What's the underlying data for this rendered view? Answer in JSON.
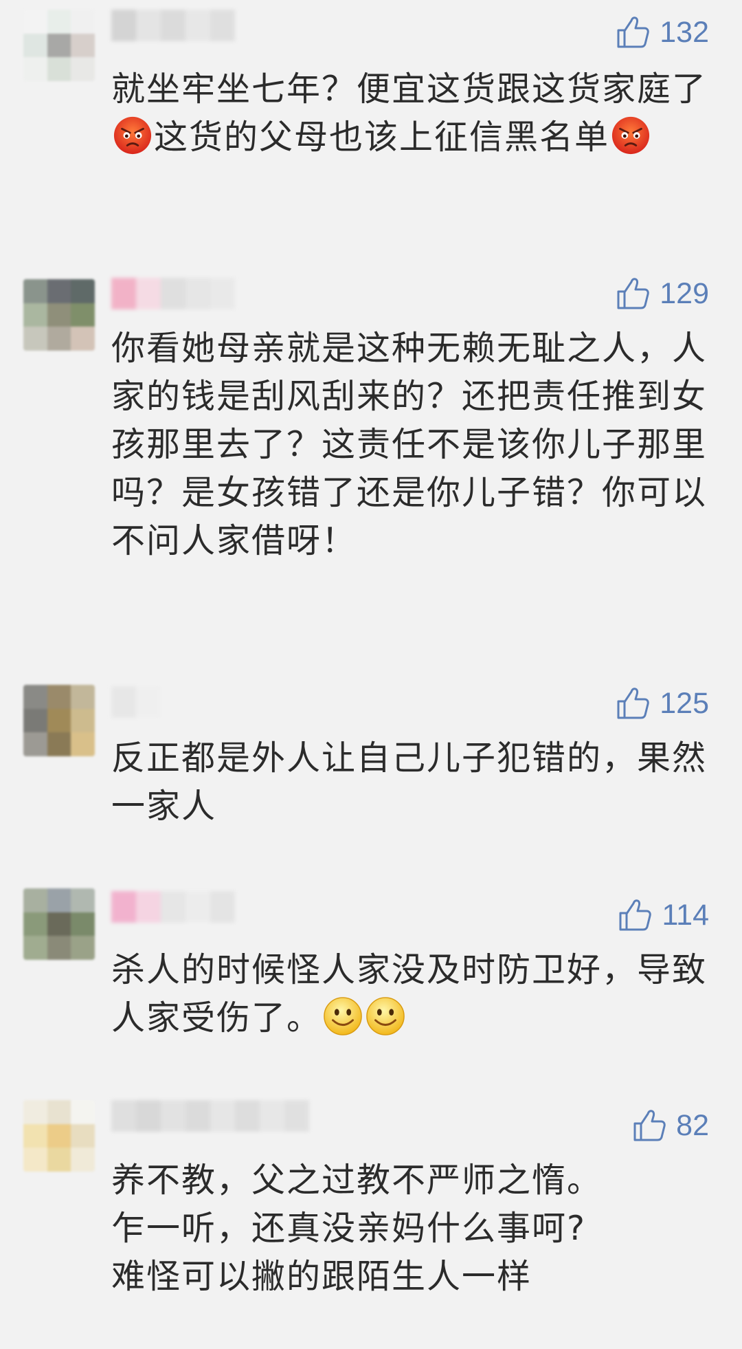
{
  "comments": [
    {
      "likes": "132",
      "text_parts": [
        "就坐牢坐七年？便宜这货跟这货家庭了",
        "这货的父母也该上征信黑名单"
      ],
      "emoji": "angry-face-icon"
    },
    {
      "likes": "129",
      "text": "你看她母亲就是这种无赖无耻之人，人家的钱是刮风刮来的？还把责任推到女孩那里去了？这责任不是该你儿子那里吗？是女孩错了还是你儿子错？你可以不问人家借呀！"
    },
    {
      "likes": "125",
      "text": "反正都是外人让自己儿子犯错的，果然一家人"
    },
    {
      "likes": "114",
      "text": "杀人的时候怪人家没及时防卫好，导致人家受伤了。",
      "emoji": "smiling-face-icon"
    },
    {
      "likes": "82",
      "lines": [
        "养不教，父之过教不严师之惰。",
        "乍一听，还真没亲妈什么事呵?",
        "难怪可以撇的跟陌生人一样"
      ]
    }
  ],
  "colors": {
    "background": "#f2f2f2",
    "like_blue": "#5b7fb8",
    "text": "#2b2b2b"
  }
}
